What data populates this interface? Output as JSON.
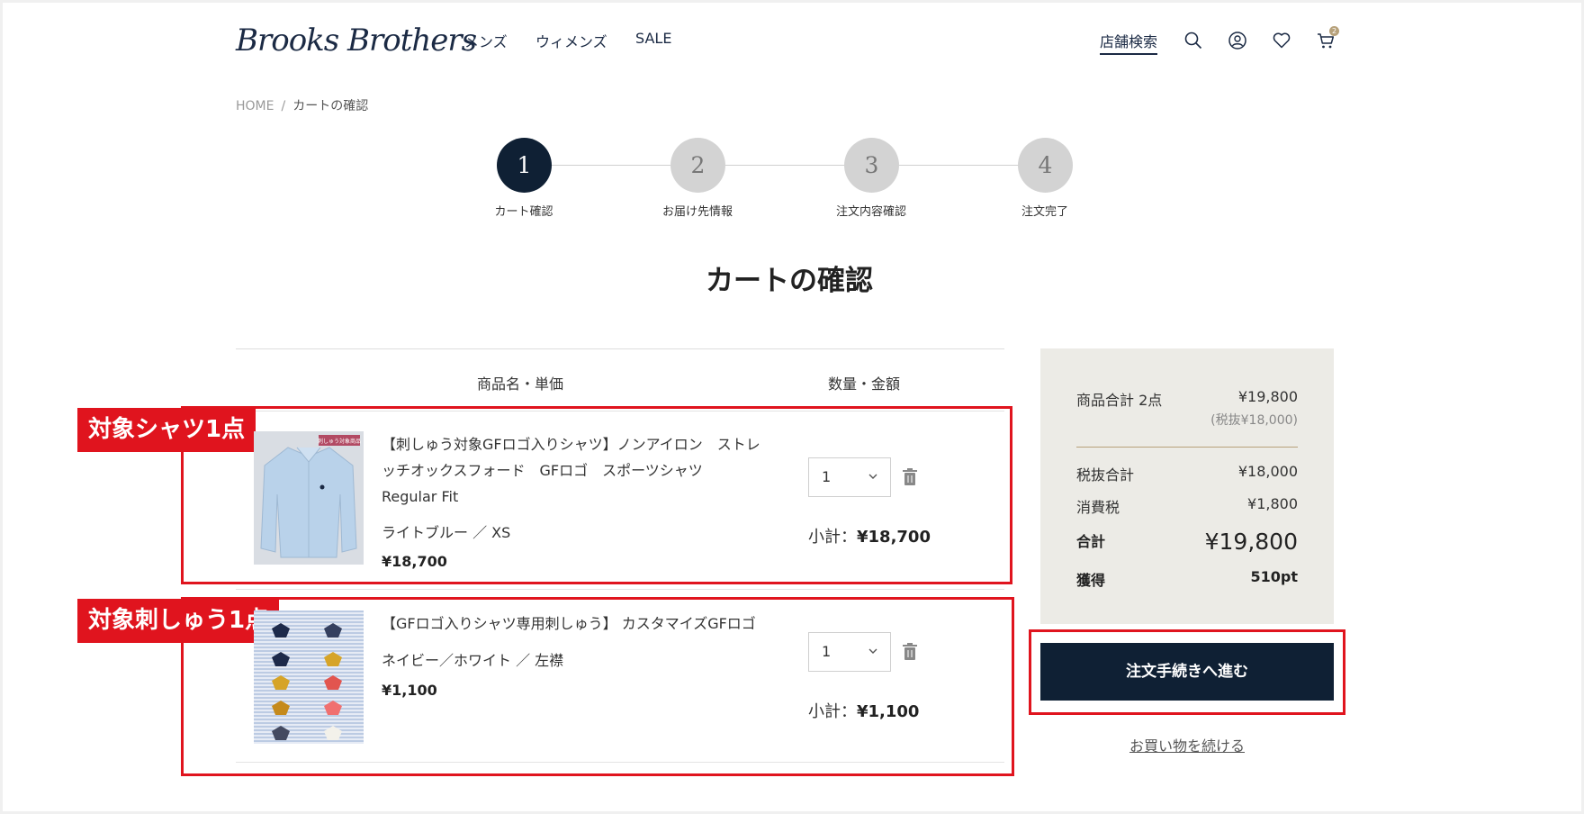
{
  "header": {
    "logo": "Brooks Brothers",
    "nav": [
      "メンズ",
      "ウィメンズ",
      "SALE"
    ],
    "store_search": "店舗検索",
    "cart_count": "2"
  },
  "breadcrumb": {
    "home": "HOME",
    "separator": "/",
    "current": "カートの確認"
  },
  "steps": [
    {
      "num": "1",
      "label": "カート確認",
      "active": true
    },
    {
      "num": "2",
      "label": "お届け先情報",
      "active": false
    },
    {
      "num": "3",
      "label": "注文内容確認",
      "active": false
    },
    {
      "num": "4",
      "label": "注文完了",
      "active": false
    }
  ],
  "page_title": "カートの確認",
  "table": {
    "col_product": "商品名・単価",
    "col_qty": "数量・金額"
  },
  "annotations": {
    "item1": "対象シャツ1点",
    "item2": "対象刺しゅう1点"
  },
  "items": [
    {
      "name_lines": [
        "【刺しゅう対象GFロゴ入りシャツ】ノンアイロン　ストレ",
        "ッチオックスフォード　GFロゴ　スポーツシャツ",
        "Regular Fit"
      ],
      "variant": "ライトブルー ／ XS",
      "price": "¥18,700",
      "qty": "1",
      "subtotal_label": "小計：",
      "subtotal_value": "¥18,700",
      "thumb_tag": "刺しゅう対象商品"
    },
    {
      "name_lines": [
        "【GFロゴ入りシャツ専用刺しゅう】 カスタマイズGFロゴ"
      ],
      "variant": "ネイビー／ホワイト ／ 左襟",
      "price": "¥1,100",
      "qty": "1",
      "subtotal_label": "小計：",
      "subtotal_value": "¥1,100"
    }
  ],
  "summary": {
    "items_label": "商品合計 2点",
    "items_value": "¥19,800",
    "items_tax_note": "(税抜¥18,000)",
    "pretax_label": "税抜合計",
    "pretax_value": "¥18,000",
    "tax_label": "消費税",
    "tax_value": "¥1,800",
    "total_label": "合計",
    "total_value": "¥19,800",
    "points_label": "獲得",
    "points_value": "510pt"
  },
  "checkout_button": "注文手続きへ進む",
  "continue_link": "お買い物を続ける",
  "colors": {
    "navy": "#0f2034",
    "accent_red": "#e0141e",
    "summary_bg": "#ecebe6",
    "gold": "#b7a17a"
  }
}
